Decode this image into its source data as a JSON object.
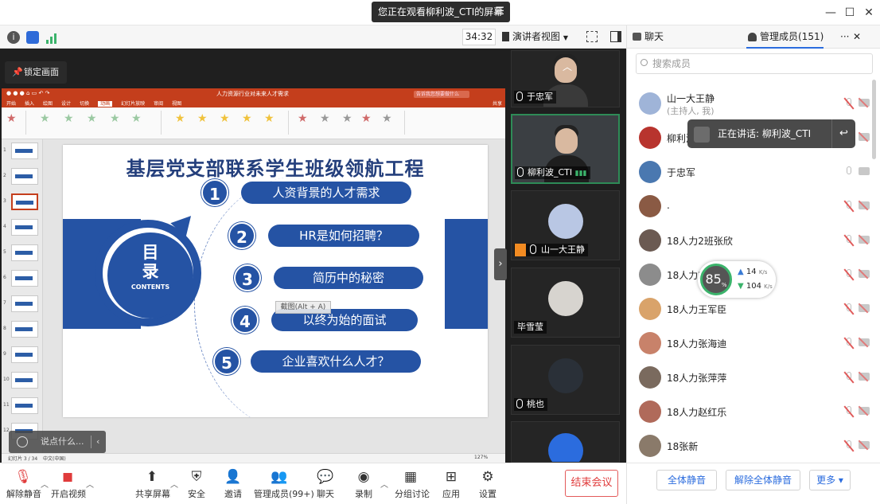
{
  "titlebar": {
    "watching": "您正在观看柳利波_CTI的屏幕",
    "minimize": "—",
    "maximize": "☐",
    "close": "✕"
  },
  "meeting_toolbar": {
    "timer": "34:32",
    "view_mode": "演讲者视图"
  },
  "share": {
    "lock_screen": "锁定画面",
    "chat_placeholder": "说点什么..."
  },
  "ppt": {
    "doc_title": "人力资源行业对未来人才需求",
    "search_placeholder": "告诉我您想要做什么",
    "tabs": [
      "开始",
      "插入",
      "绘图",
      "设计",
      "切换",
      "动画",
      "幻灯片放映",
      "审阅",
      "视图"
    ],
    "active_tab": "动画",
    "share_label": "共享",
    "status": "幻灯片 3 / 34",
    "status_lang": "中文(中国)",
    "zoom": "127%",
    "thumb_numbers": [
      "1",
      "2",
      "3",
      "4",
      "5",
      "6",
      "7",
      "8",
      "9",
      "10",
      "11",
      "12"
    ],
    "screenshot_tip": "截图(Alt + A)"
  },
  "slide": {
    "title": "基层党支部联系学生班级领航工程",
    "circle_text_1": "目",
    "circle_text_2": "录",
    "circle_text_en": "CONTENTS",
    "items": [
      {
        "num": "1",
        "text": "人资背景的人才需求"
      },
      {
        "num": "2",
        "text": "HR是如何招聘？"
      },
      {
        "num": "3",
        "text": "简历中的秘密"
      },
      {
        "num": "4",
        "text": "以终为始的面试"
      },
      {
        "num": "5",
        "text": "企业喜欢什么人才？"
      }
    ]
  },
  "videos": [
    {
      "name": "于忠军"
    },
    {
      "name": "柳利波_CTI"
    },
    {
      "name": "山一大王静"
    },
    {
      "name": "毕雪莹"
    },
    {
      "name": "桃也"
    }
  ],
  "panel": {
    "tab_chat": "聊天",
    "tab_members": "管理成员(151)",
    "more": "···",
    "close": "✕",
    "search_placeholder": "搜索成员",
    "speaking_tip": "正在讲话: 柳利波_CTI",
    "members": [
      {
        "name": "山一大王静",
        "role": "(主持人, 我)",
        "mic": "off",
        "avatar_color": "#9fb4d8"
      },
      {
        "name": "柳利波",
        "role": "",
        "mic": "off",
        "avatar_color": "#b8342e"
      },
      {
        "name": "于忠军",
        "role": "",
        "mic": "on",
        "avatar_color": "#4a78b0"
      },
      {
        "name": ".",
        "role": "",
        "mic": "off",
        "avatar_color": "#8a5a44"
      },
      {
        "name": "18人力2班张欣",
        "role": "",
        "mic": "off",
        "avatar_color": "#6b5a52"
      },
      {
        "name": "18人力2",
        "role": "",
        "mic": "off",
        "avatar_color": "#8c8c8c"
      },
      {
        "name": "18人力王军臣",
        "role": "",
        "mic": "off",
        "avatar_color": "#d9a36a"
      },
      {
        "name": "18人力张海迪",
        "role": "",
        "mic": "off",
        "avatar_color": "#c8826a"
      },
      {
        "name": "18人力张萍萍",
        "role": "",
        "mic": "off",
        "avatar_color": "#7a6a5e"
      },
      {
        "name": "18人力赵红乐",
        "role": "",
        "mic": "off",
        "avatar_color": "#b06a5a"
      },
      {
        "name": "18张新",
        "role": "",
        "mic": "off",
        "avatar_color": "#8a7a6a"
      }
    ],
    "network": {
      "score": "85",
      "score_unit": "%",
      "up": "14",
      "down": "104",
      "unit": "K/s"
    },
    "mute_all": "全体静音",
    "unmute_all": "解除全体静音",
    "more_btn": "更多 ▾"
  },
  "bottombar": {
    "unmute": "解除静音",
    "video": "开启视频",
    "share_screen": "共享屏幕",
    "security": "安全",
    "invite": "邀请",
    "members": "管理成员(99+)",
    "chat": "聊天",
    "record": "录制",
    "breakout": "分组讨论",
    "apps": "应用",
    "settings": "设置",
    "end_meeting": "结束会议"
  },
  "colors": {
    "ppt_red": "#c43e1c",
    "slide_blue": "#2553a4",
    "accent_blue": "#2b6cde",
    "end_red": "#e03b3b",
    "net_green": "#3bb36b"
  }
}
